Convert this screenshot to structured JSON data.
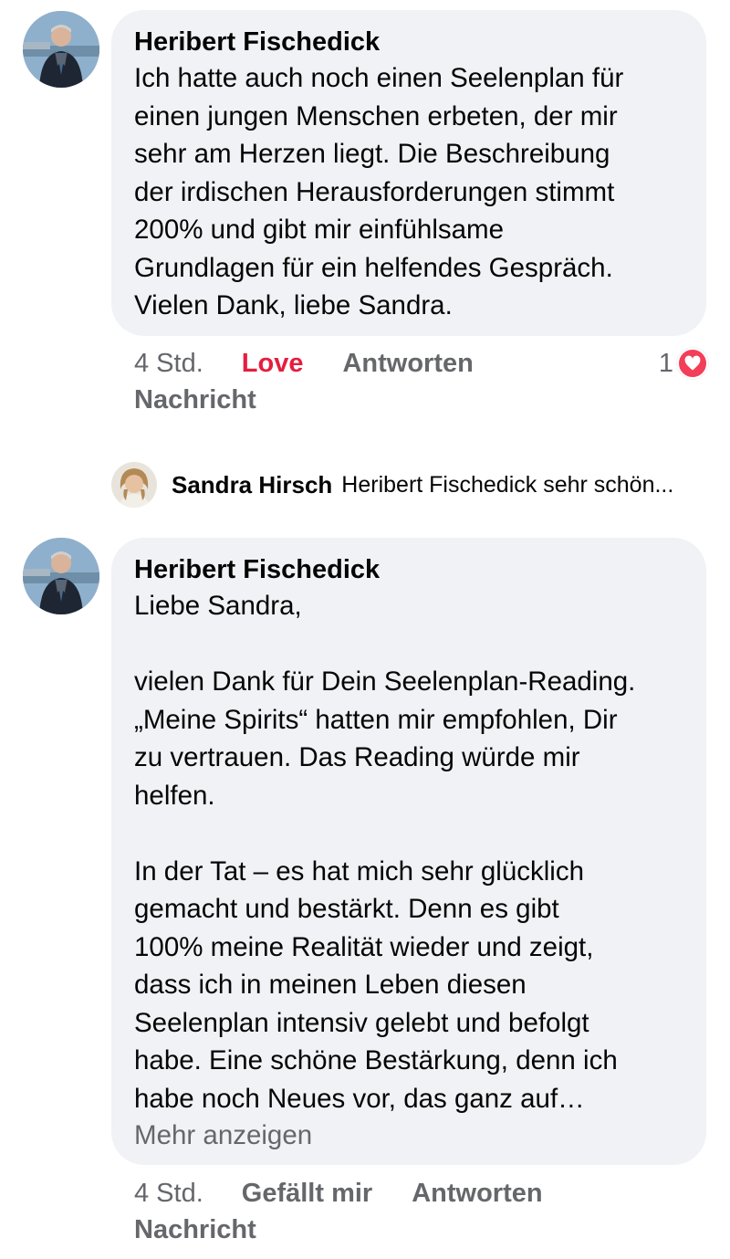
{
  "comments": [
    {
      "author": "Heribert Fischedick",
      "text": "Ich hatte auch noch einen Seelenplan für\neinen jungen Menschen erbeten, der mir\nsehr am Herzen liegt. Die Beschreibung\nder irdischen Herausforderungen stimmt\n200% und gibt mir einfühlsame\nGrundlagen für ein helfendes Gespräch.\nVielen Dank, liebe Sandra.",
      "time": "4 Std.",
      "like_label": "Love",
      "reply_label": "Antworten",
      "message_label": "Nachricht",
      "reaction_count": "1",
      "reaction_icon": "heart-icon",
      "reaction_color": "#f33e58",
      "like_color": "#e41e3f"
    },
    {
      "author": "Heribert Fischedick",
      "text": "Liebe Sandra,\n\nvielen Dank für Dein Seelenplan-Reading.\n„Meine Spirits“ hatten mir empfohlen, Dir\nzu vertrauen. Das Reading würde mir\nhelfen.\n\nIn der Tat – es hat mich sehr glücklich\ngemacht und bestärkt. Denn es gibt\n100% meine Realität wieder und zeigt,\ndass ich in meinen Leben diesen\nSeelenplan intensiv gelebt und befolgt\nhabe. Eine schöne Bestärkung, denn ich\nhabe noch Neues vor, das ganz auf…",
      "more_label": "Mehr anzeigen",
      "time": "4 Std.",
      "like_label": "Gefällt mir",
      "reply_label": "Antworten",
      "message_label": "Nachricht"
    }
  ],
  "reply_preview": {
    "author": "Sandra Hirsch",
    "text": "Heribert Fischedick sehr schön..."
  },
  "colors": {
    "bubble": "#f0f2f5",
    "secondary_text": "#65676b",
    "primary_text": "#050505"
  }
}
